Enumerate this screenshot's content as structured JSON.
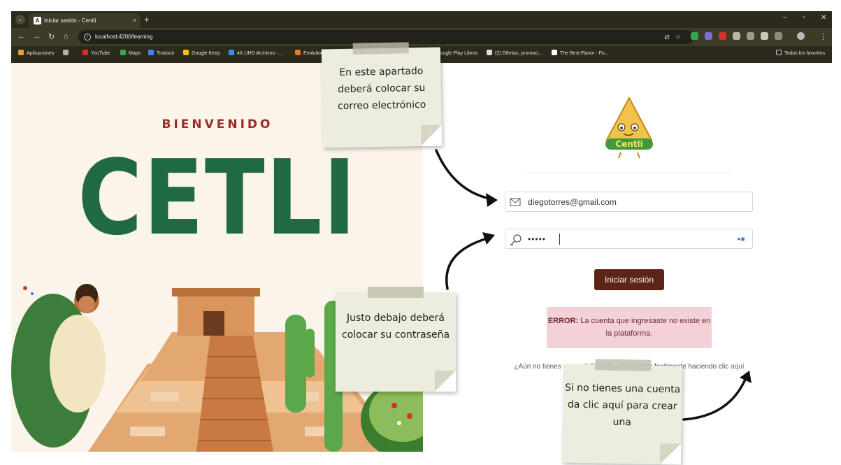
{
  "browser": {
    "tab_title": "Iniciar sesión - Centli",
    "tab_close": "×",
    "new_tab": "+",
    "favicon": "A",
    "url": "localhost:4200/learning",
    "window_controls": [
      "–",
      "▫",
      "✕"
    ],
    "nav_icons": [
      "back-icon",
      "forward-icon",
      "reload-icon",
      "home-icon"
    ],
    "bookmarks": [
      {
        "label": "Aplicaciones",
        "icon": "apps-icon",
        "color": "#e0a030"
      },
      {
        "label": "YouTube",
        "icon": "youtube-icon",
        "color": "#e02b20"
      },
      {
        "label": "Maps",
        "icon": "maps-icon",
        "color": "#34a853"
      },
      {
        "label": "Traducir",
        "icon": "translate-icon",
        "color": "#4285f4"
      },
      {
        "label": "Google Keep",
        "icon": "keep-icon",
        "color": "#f4c20d"
      },
      {
        "label": "4K UHD Archivos -...",
        "icon": "drive-icon",
        "color": "#3c8fe0"
      },
      {
        "label": "Evolution",
        "icon": "evolution-icon",
        "color": "#e57b2d"
      },
      {
        "label": "Google Play Libros",
        "icon": "play-books-icon",
        "color": "#4285f4"
      },
      {
        "label": "(2) Ofertas, promoci...",
        "icon": "offers-icon",
        "color": "#dddddd"
      },
      {
        "label": "The Best Flavor - Fo...",
        "icon": "angular-icon",
        "color": "#ffffff"
      }
    ],
    "all_bookmarks": "Todos los favoritos"
  },
  "poster": {
    "welcome": "BIENVENIDO",
    "brand": "CETLI"
  },
  "login": {
    "logo_text": "Centli",
    "email_value": "diegotorres@gmail.com",
    "password_value": "•••••",
    "submit_label": "Iniciar sesión",
    "error_title": "ERROR:",
    "error_message": " La cuenta que ingresaste no existe en la plataforma.",
    "signup_prefix": "¿Aún no tienes cuenta? Registra una cuenta facilmente haciendo clic ",
    "signup_link": "aquí"
  },
  "notes": {
    "email": "En este apartado deberá colocar su correo electrónico",
    "password": "Justo debajo deberá colocar su contraseña",
    "signup": "Si no tienes una cuenta da clic aquí para crear una"
  }
}
